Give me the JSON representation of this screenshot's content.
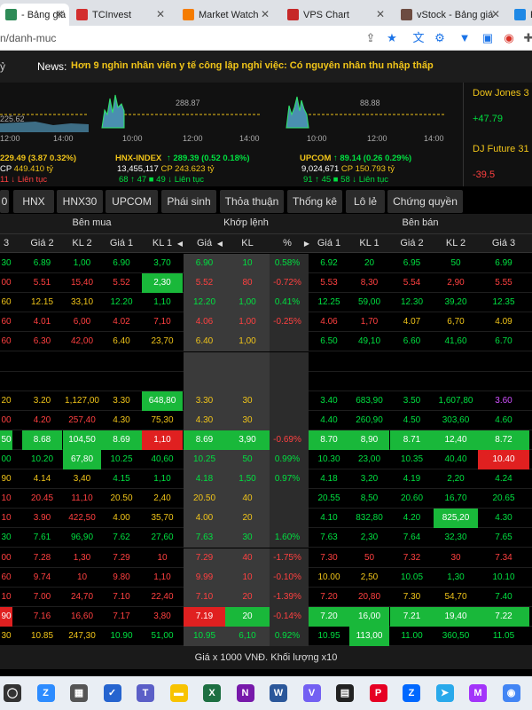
{
  "browser": {
    "tabs": [
      {
        "label": "- Bảng giá",
        "favicon": "vps-icon",
        "color": "#2e8b57",
        "active": true,
        "closable": true
      },
      {
        "label": "TCInvest",
        "favicon": "tcinvest-icon",
        "color": "#d32f2f",
        "active": false,
        "closable": true
      },
      {
        "label": "Market Watch",
        "favicon": "market-watch-icon",
        "color": "#f57c00",
        "active": false,
        "closable": true
      },
      {
        "label": "VPS Chart",
        "favicon": "vps-chart-icon",
        "color": "#c62828",
        "active": false,
        "closable": true
      },
      {
        "label": "vStock - Bảng giá",
        "favicon": "vstock-icon",
        "color": "#6d4c41",
        "active": false,
        "closable": true
      },
      {
        "label": "Fi",
        "favicon": "fi-icon",
        "color": "#1e88e5",
        "active": false,
        "closable": false
      }
    ],
    "url": "n/danh-muc"
  },
  "header": {
    "left_text": "ỷ",
    "news_label": "News:",
    "news_text": "Hơn 9 nghìn nhân viên y tế công lập nghỉ việc: Có nguyên nhân thu nhập thấp"
  },
  "indices": [
    {
      "name": "",
      "ref_label": "225.62",
      "times": [
        "12:00",
        "14:00"
      ],
      "line1": "229.49 (3.87 0.32%)",
      "line1_color": "#f0c419",
      "line2_a": "CP",
      "line2_b": "449.410 tỷ",
      "line3": "11 ↓ Liên tục",
      "line3_color": "#ff4040"
    },
    {
      "name": "HNX-INDEX",
      "ref_label": "288.87",
      "times": [
        "10:00",
        "12:00",
        "14:00"
      ],
      "line1": "↑ 289.39 (0.52 0.18%)",
      "line1_color": "#00e040",
      "line2_a": "13,455,117",
      "line2_b": "CP 243.623 tỷ",
      "line3": "68 ↑ 47 ■ 49 ↓ Liên tục",
      "line3_color": "#00e040"
    },
    {
      "name": "UPCOM",
      "ref_label": "88.88",
      "times": [
        "10:00",
        "12:00",
        "14:00"
      ],
      "line1": "↑ 89.14 (0.26 0.29%)",
      "line1_color": "#00e040",
      "line2_a": "9,024,671",
      "line2_b": "CP 150.793 tỷ",
      "line3": "91 ↑ 45 ■ 58 ↓ Liên tục",
      "line3_color": "#00e040"
    }
  ],
  "world": [
    {
      "name": "Dow Jones",
      "suffix": "3",
      "value": "+47.79",
      "color": "#00e040"
    },
    {
      "name": "DJ Future",
      "suffix": "31",
      "value": "-39.5",
      "color": "#ff4040"
    }
  ],
  "market_tabs": [
    "0",
    "HNX",
    "HNX30",
    "UPCOM",
    "Phái sinh",
    "Thỏa thuận",
    "Thống kê",
    "Lô lẻ",
    "Chứng quyền"
  ],
  "groups": {
    "buy": "Bên mua",
    "match": "Khớp lệnh",
    "sell": "Bên bán"
  },
  "columns": [
    "3",
    "Giá 2",
    "KL 2",
    "Giá 1",
    "KL 1",
    "Giá",
    "KL",
    "%",
    "Giá 1",
    "KL 1",
    "Giá 2",
    "KL 2",
    "Giá 3"
  ],
  "colors": {
    "green": "#00e040",
    "red": "#ff4040",
    "yellow": "#f0c419",
    "purple": "#d050ff",
    "cyan": "#40e0ff",
    "white": "#ffffff",
    "green_bg": "#19b83a",
    "red_bg": "#e02020"
  },
  "rows": [
    {
      "c": [
        "30",
        "6.89",
        "1,00",
        "6.90",
        "3,70",
        "6.90",
        "10",
        "0.58%",
        "6.92",
        "20",
        "6.95",
        "50",
        "6.99"
      ],
      "col": [
        "g",
        "g",
        "g",
        "g",
        "g",
        "g",
        "g",
        "g",
        "g",
        "g",
        "g",
        "g",
        "g"
      ],
      "hl": []
    },
    {
      "c": [
        "00",
        "5.51",
        "15,40",
        "5.52",
        "2,30",
        "5.52",
        "80",
        "-0.72%",
        "5.53",
        "8,30",
        "5.54",
        "2,90",
        "5.55"
      ],
      "col": [
        "r",
        "r",
        "r",
        "r",
        "w",
        "r",
        "r",
        "r",
        "r",
        "r",
        "r",
        "r",
        "r"
      ],
      "hl": [
        4
      ]
    },
    {
      "c": [
        "60",
        "12.15",
        "33,10",
        "12.20",
        "1,10",
        "12.20",
        "1,00",
        "0.41%",
        "12.25",
        "59,00",
        "12.30",
        "39,20",
        "12.35"
      ],
      "col": [
        "y",
        "y",
        "y",
        "g",
        "g",
        "g",
        "g",
        "g",
        "g",
        "g",
        "g",
        "g",
        "g"
      ],
      "hl": []
    },
    {
      "c": [
        "60",
        "4.01",
        "6,00",
        "4.02",
        "7,10",
        "4.06",
        "1,00",
        "-0.25%",
        "4.06",
        "1,70",
        "4.07",
        "6,70",
        "4.09"
      ],
      "col": [
        "r",
        "r",
        "r",
        "r",
        "r",
        "r",
        "r",
        "r",
        "r",
        "r",
        "y",
        "y",
        "y"
      ],
      "hl": []
    },
    {
      "c": [
        "60",
        "6.30",
        "42,00",
        "6.40",
        "23,70",
        "6.40",
        "1,00",
        "",
        "6.50",
        "49,10",
        "6.60",
        "41,60",
        "6.70"
      ],
      "col": [
        "r",
        "r",
        "r",
        "y",
        "y",
        "y",
        "y",
        "y",
        "g",
        "g",
        "g",
        "g",
        "g"
      ],
      "hl": []
    },
    {
      "c": [
        "",
        "",
        "",
        "",
        "",
        "",
        "",
        "",
        "",
        "",
        "",
        "",
        ""
      ],
      "col": [
        "w",
        "w",
        "w",
        "w",
        "w",
        "w",
        "w",
        "w",
        "w",
        "w",
        "w",
        "w",
        "w"
      ],
      "hl": []
    },
    {
      "c": [
        "",
        "",
        "",
        "",
        "",
        "",
        "",
        "",
        "",
        "",
        "",
        "",
        ""
      ],
      "col": [
        "w",
        "w",
        "w",
        "w",
        "w",
        "w",
        "w",
        "w",
        "w",
        "w",
        "w",
        "w",
        "w"
      ],
      "hl": []
    },
    {
      "c": [
        "20",
        "3.20",
        "1,127,00",
        "3.30",
        "648,80",
        "3.30",
        "30",
        "",
        "3.40",
        "683,90",
        "3.50",
        "1,607,80",
        "3.60"
      ],
      "col": [
        "y",
        "y",
        "y",
        "y",
        "w",
        "y",
        "y",
        "y",
        "g",
        "g",
        "g",
        "g",
        "p"
      ],
      "hl": [
        4
      ]
    },
    {
      "c": [
        "00",
        "4.20",
        "257,40",
        "4.30",
        "75,30",
        "4.30",
        "30",
        "",
        "4.40",
        "260,90",
        "4.50",
        "303,60",
        "4.60"
      ],
      "col": [
        "r",
        "r",
        "r",
        "y",
        "y",
        "y",
        "y",
        "y",
        "g",
        "g",
        "g",
        "g",
        "g"
      ],
      "hl": []
    },
    {
      "c": [
        "50",
        "8.68",
        "104,50",
        "8.69",
        "1,10",
        "8.69",
        "3,90",
        "-0.69%",
        "8.70",
        "8,90",
        "8.71",
        "12,40",
        "8.72"
      ],
      "col": [
        "w",
        "w",
        "w",
        "w",
        "w",
        "w",
        "w",
        "r",
        "w",
        "w",
        "w",
        "w",
        "w"
      ],
      "hl": [
        0,
        1,
        2,
        3,
        5,
        6,
        8,
        9,
        10,
        11,
        12
      ],
      "hlr": [
        4
      ]
    },
    {
      "c": [
        "00",
        "10.20",
        "67,80",
        "10.25",
        "40,60",
        "10.25",
        "50",
        "0.99%",
        "10.30",
        "23,00",
        "10.35",
        "40,40",
        "10.40"
      ],
      "col": [
        "g",
        "g",
        "w",
        "g",
        "g",
        "g",
        "g",
        "g",
        "g",
        "g",
        "g",
        "g",
        "g"
      ],
      "hl": [
        2
      ],
      "hlr": [
        12
      ]
    },
    {
      "c": [
        "90",
        "4.14",
        "3,40",
        "4.15",
        "1,10",
        "4.18",
        "1,50",
        "0.97%",
        "4.18",
        "3,20",
        "4.19",
        "2,20",
        "4.24"
      ],
      "col": [
        "y",
        "y",
        "y",
        "g",
        "g",
        "g",
        "g",
        "g",
        "g",
        "g",
        "g",
        "g",
        "g"
      ],
      "hl": []
    },
    {
      "c": [
        "10",
        "20.45",
        "11,10",
        "20.50",
        "2,40",
        "20.50",
        "40",
        "",
        "20.55",
        "8,50",
        "20.60",
        "16,70",
        "20.65"
      ],
      "col": [
        "r",
        "r",
        "r",
        "y",
        "y",
        "y",
        "y",
        "y",
        "g",
        "g",
        "g",
        "g",
        "g"
      ],
      "hl": []
    },
    {
      "c": [
        "10",
        "3.90",
        "422,50",
        "4.00",
        "35,70",
        "4.00",
        "20",
        "",
        "4.10",
        "832,80",
        "4.20",
        "825,20",
        "4.30"
      ],
      "col": [
        "r",
        "r",
        "r",
        "y",
        "y",
        "y",
        "y",
        "y",
        "g",
        "g",
        "g",
        "w",
        "g"
      ],
      "hl": [
        11
      ]
    },
    {
      "c": [
        "30",
        "7.61",
        "96,90",
        "7.62",
        "27,60",
        "7.63",
        "30",
        "1.60%",
        "7.63",
        "2,30",
        "7.64",
        "32,30",
        "7.65"
      ],
      "col": [
        "g",
        "g",
        "g",
        "g",
        "g",
        "g",
        "g",
        "g",
        "g",
        "g",
        "g",
        "g",
        "g"
      ],
      "hl": []
    },
    {
      "c": [
        "00",
        "7.28",
        "1,30",
        "7.29",
        "10",
        "7.29",
        "40",
        "-1.75%",
        "7.30",
        "50",
        "7.32",
        "30",
        "7.34"
      ],
      "col": [
        "r",
        "r",
        "r",
        "r",
        "r",
        "r",
        "r",
        "r",
        "r",
        "r",
        "r",
        "r",
        "r"
      ],
      "hl": []
    },
    {
      "c": [
        "60",
        "9.74",
        "10",
        "9.80",
        "1,10",
        "9.99",
        "10",
        "-0.10%",
        "10.00",
        "2,50",
        "10.05",
        "1,30",
        "10.10"
      ],
      "col": [
        "r",
        "r",
        "r",
        "r",
        "r",
        "r",
        "r",
        "r",
        "y",
        "y",
        "g",
        "g",
        "g"
      ],
      "hl": []
    },
    {
      "c": [
        "10",
        "7.00",
        "24,70",
        "7.10",
        "22,40",
        "7.10",
        "20",
        "-1.39%",
        "7.20",
        "20,80",
        "7.30",
        "54,70",
        "7.40"
      ],
      "col": [
        "r",
        "r",
        "r",
        "r",
        "r",
        "r",
        "r",
        "r",
        "r",
        "r",
        "y",
        "y",
        "g"
      ],
      "hl": []
    },
    {
      "c": [
        "90",
        "7.16",
        "16,60",
        "7.17",
        "3,80",
        "7.19",
        "20",
        "-0.14%",
        "7.20",
        "16,00",
        "7.21",
        "19,40",
        "7.22"
      ],
      "col": [
        "r",
        "r",
        "r",
        "r",
        "r",
        "w",
        "w",
        "r",
        "w",
        "w",
        "w",
        "w",
        "w"
      ],
      "hl": [
        6,
        8,
        9,
        10,
        11,
        12
      ],
      "hlr": [
        0,
        5
      ]
    },
    {
      "c": [
        "30",
        "10.85",
        "247,30",
        "10.90",
        "51,00",
        "10.95",
        "6,10",
        "0.92%",
        "10.95",
        "113,00",
        "11.00",
        "360,50",
        "11.05"
      ],
      "col": [
        "y",
        "y",
        "y",
        "g",
        "g",
        "g",
        "g",
        "g",
        "g",
        "w",
        "g",
        "g",
        "g"
      ],
      "hl": [
        9
      ]
    }
  ],
  "footer": "Giá x 1000 VNĐ. Khối lượng x10",
  "taskbar": [
    {
      "name": "start-icon",
      "color": "#333",
      "glyph": "◯"
    },
    {
      "name": "zoom-icon",
      "color": "#2d8cff",
      "glyph": "Z"
    },
    {
      "name": "store-icon",
      "color": "#555",
      "glyph": "▦"
    },
    {
      "name": "todo-icon",
      "color": "#2564cf",
      "glyph": "✓"
    },
    {
      "name": "teams-icon",
      "color": "#5b5fc7",
      "glyph": "T"
    },
    {
      "name": "explorer-icon",
      "color": "#f8c300",
      "glyph": "▬"
    },
    {
      "name": "excel-icon",
      "color": "#1d6f42",
      "glyph": "X"
    },
    {
      "name": "onenote-icon",
      "color": "#7719aa",
      "glyph": "N"
    },
    {
      "name": "word-icon",
      "color": "#2b579a",
      "glyph": "W"
    },
    {
      "name": "viber-icon",
      "color": "#7360f2",
      "glyph": "V"
    },
    {
      "name": "sheets-icon",
      "color": "#222",
      "glyph": "▤"
    },
    {
      "name": "pinterest-icon",
      "color": "#e60023",
      "glyph": "P"
    },
    {
      "name": "zalo-icon",
      "color": "#0068ff",
      "glyph": "Z"
    },
    {
      "name": "telegram-icon",
      "color": "#29a9eb",
      "glyph": "➤"
    },
    {
      "name": "messenger-icon",
      "color": "#a334fa",
      "glyph": "M"
    },
    {
      "name": "chrome-icon",
      "color": "#4285f4",
      "glyph": "◉"
    }
  ]
}
